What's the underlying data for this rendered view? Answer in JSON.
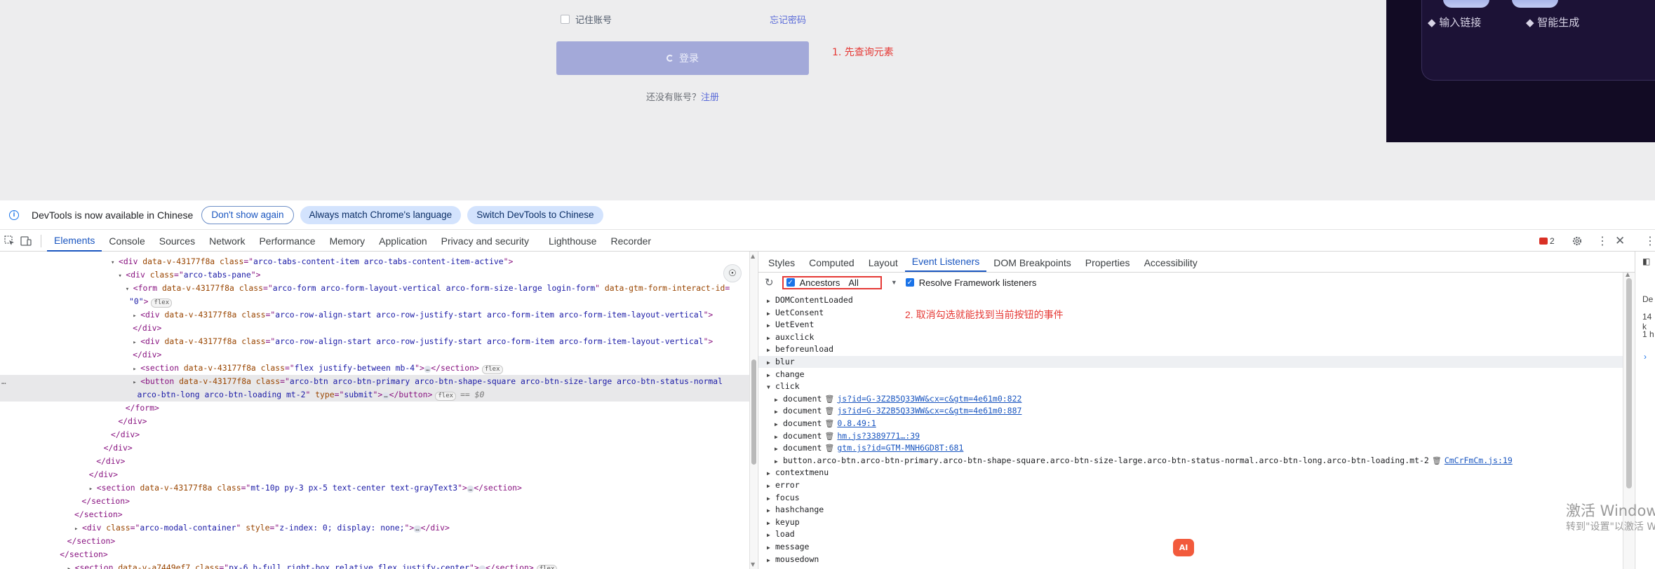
{
  "webpage": {
    "remember_label": "记住账号",
    "forgot_label": "忘记密码",
    "login_label": "登录",
    "annotation_1": "1. 先查询元素",
    "no_account_text": "还没有账号？",
    "signup_label": "注册",
    "promo_items": [
      "◆ 输入链接",
      "◆ 智能生成"
    ]
  },
  "banner": {
    "text": "DevTools is now available in Chinese",
    "btn_dont_show": "Don't show again",
    "btn_match": "Always match Chrome's language",
    "btn_switch": "Switch DevTools to Chinese"
  },
  "toolbar": {
    "tabs": [
      "Elements",
      "Console",
      "Sources",
      "Network",
      "Performance",
      "Memory",
      "Application",
      "Privacy and security",
      "Lighthouse",
      "Recorder"
    ],
    "error_count": "2"
  },
  "elements": {
    "lines": [
      {
        "indent": 8,
        "tri": "▾",
        "parts": [
          [
            "tag",
            "<div "
          ],
          [
            "attr",
            "data-v-43177f8a "
          ],
          [
            "attr",
            "class"
          ],
          [
            "tag",
            "=\""
          ],
          [
            "val",
            "arco-tabs-content-item arco-tabs-content-item-active"
          ],
          [
            "tag",
            "\">"
          ]
        ]
      },
      {
        "indent": 9,
        "tri": "▾",
        "parts": [
          [
            "tag",
            "<div "
          ],
          [
            "attr",
            "class"
          ],
          [
            "tag",
            "=\""
          ],
          [
            "val",
            "arco-tabs-pane"
          ],
          [
            "tag",
            "\">"
          ]
        ]
      },
      {
        "indent": 10,
        "tri": "▾",
        "parts": [
          [
            "tag",
            "<form "
          ],
          [
            "attr",
            "data-v-43177f8a "
          ],
          [
            "attr",
            "class"
          ],
          [
            "tag",
            "=\""
          ],
          [
            "val",
            "arco-form arco-form-layout-vertical arco-form-size-large login-form"
          ],
          [
            "tag",
            "\" "
          ],
          [
            "attr",
            "data-gtm-form-interact-id"
          ],
          [
            "tag",
            "="
          ]
        ]
      },
      {
        "indent": 10.5,
        "tri": "",
        "parts": [
          [
            "val",
            "\"0\""
          ],
          [
            "tag",
            ">"
          ]
        ],
        "pill": "flex"
      },
      {
        "indent": 11,
        "tri": "▸",
        "parts": [
          [
            "tag",
            "<div "
          ],
          [
            "attr",
            "data-v-43177f8a "
          ],
          [
            "attr",
            "class"
          ],
          [
            "tag",
            "=\""
          ],
          [
            "val",
            "arco-row-align-start arco-row-justify-start arco-form-item arco-form-item-layout-vertical"
          ],
          [
            "tag",
            "\">"
          ]
        ]
      },
      {
        "indent": 11,
        "tri": "",
        "parts": [
          [
            "tag",
            "</div>"
          ]
        ]
      },
      {
        "indent": 11,
        "tri": "▸",
        "parts": [
          [
            "tag",
            "<div "
          ],
          [
            "attr",
            "data-v-43177f8a "
          ],
          [
            "attr",
            "class"
          ],
          [
            "tag",
            "=\""
          ],
          [
            "val",
            "arco-row-align-start arco-row-justify-start arco-form-item arco-form-item-layout-vertical"
          ],
          [
            "tag",
            "\">"
          ]
        ]
      },
      {
        "indent": 11,
        "tri": "",
        "parts": [
          [
            "tag",
            "</div>"
          ]
        ]
      },
      {
        "indent": 11,
        "tri": "▸",
        "parts": [
          [
            "tag",
            "<section "
          ],
          [
            "attr",
            "data-v-43177f8a "
          ],
          [
            "attr",
            "class"
          ],
          [
            "tag",
            "=\""
          ],
          [
            "val",
            "flex justify-between mb-4"
          ],
          [
            "tag",
            "\">"
          ]
        ],
        "dots": true,
        "after": "</section>",
        "pill": "flex"
      },
      {
        "indent": 11,
        "tri": "▸",
        "parts": [
          [
            "tag",
            "<button "
          ],
          [
            "attr",
            "data-v-43177f8a "
          ],
          [
            "attr",
            "class"
          ],
          [
            "tag",
            "=\""
          ],
          [
            "val",
            "arco-btn arco-btn-primary arco-btn-shape-square arco-btn-size-large arco-btn-status-normal"
          ]
        ],
        "sel": true
      },
      {
        "indent": 11.6,
        "tri": "",
        "parts": [
          [
            "val",
            "arco-btn-long arco-btn-loading mt-2"
          ],
          [
            "tag",
            "\" "
          ],
          [
            "attr",
            "type"
          ],
          [
            "tag",
            "=\""
          ],
          [
            "val",
            "submit"
          ],
          [
            "tag",
            "\">"
          ]
        ],
        "dots": true,
        "after": "</button>",
        "pill": "flex",
        "eq": "== $0",
        "sel": true
      },
      {
        "indent": 10,
        "tri": "",
        "parts": [
          [
            "tag",
            "</form>"
          ]
        ]
      },
      {
        "indent": 9,
        "tri": "",
        "parts": [
          [
            "tag",
            "</div>"
          ]
        ]
      },
      {
        "indent": 8,
        "tri": "",
        "parts": [
          [
            "tag",
            "</div>"
          ]
        ]
      },
      {
        "indent": 7,
        "tri": "",
        "parts": [
          [
            "tag",
            "</div>"
          ]
        ]
      },
      {
        "indent": 6,
        "tri": "",
        "parts": [
          [
            "tag",
            "</div>"
          ]
        ]
      },
      {
        "indent": 5,
        "tri": "",
        "parts": [
          [
            "tag",
            "</div>"
          ]
        ]
      },
      {
        "indent": 5,
        "tri": "▸",
        "parts": [
          [
            "tag",
            "<section "
          ],
          [
            "attr",
            "data-v-43177f8a "
          ],
          [
            "attr",
            "class"
          ],
          [
            "tag",
            "=\""
          ],
          [
            "val",
            "mt-10p py-3 px-5 text-center text-grayText3"
          ],
          [
            "tag",
            "\">"
          ]
        ],
        "dots": true,
        "after": "</section>"
      },
      {
        "indent": 4,
        "tri": "",
        "parts": [
          [
            "tag",
            "</section>"
          ]
        ]
      },
      {
        "indent": 3,
        "tri": "",
        "parts": [
          [
            "tag",
            "</section>"
          ]
        ]
      },
      {
        "indent": 3,
        "tri": "▸",
        "parts": [
          [
            "tag",
            "<div "
          ],
          [
            "attr",
            "class"
          ],
          [
            "tag",
            "=\""
          ],
          [
            "val",
            "arco-modal-container"
          ],
          [
            "tag",
            "\" "
          ],
          [
            "attr",
            "style"
          ],
          [
            "tag",
            "=\""
          ],
          [
            "val",
            "z-index: 0; display: none;"
          ],
          [
            "tag",
            "\">"
          ]
        ],
        "dots": true,
        "after": "</div>"
      },
      {
        "indent": 2,
        "tri": "",
        "parts": [
          [
            "tag",
            "</section>"
          ]
        ]
      },
      {
        "indent": 1,
        "tri": "",
        "parts": [
          [
            "tag",
            "</section>"
          ]
        ]
      },
      {
        "indent": 2,
        "tri": "▸",
        "parts": [
          [
            "tag",
            "<section "
          ],
          [
            "attr",
            "data-v-a7449ef7 "
          ],
          [
            "attr",
            "class"
          ],
          [
            "tag",
            "=\""
          ],
          [
            "val",
            "px-6 h-full right-box relative flex justify-center"
          ],
          [
            "tag",
            "\">"
          ]
        ],
        "dots": true,
        "after": "</section>",
        "pill": "flex"
      }
    ]
  },
  "sidebar": {
    "tabs": [
      "Styles",
      "Computed",
      "Layout",
      "Event Listeners",
      "DOM Breakpoints",
      "Properties",
      "Accessibility"
    ],
    "ancestors_label": "Ancestors",
    "filter_value": "All",
    "resolve_label": "Resolve Framework listeners",
    "annotation_2": "2. 取消勾选就能找到当前按钮的事件",
    "events": [
      {
        "name": "DOMContentLoaded",
        "open": false
      },
      {
        "name": "UetConsent",
        "open": false
      },
      {
        "name": "UetEvent",
        "open": false
      },
      {
        "name": "auxclick",
        "open": false
      },
      {
        "name": "beforeunload",
        "open": false
      },
      {
        "name": "blur",
        "open": false,
        "hl": true
      },
      {
        "name": "change",
        "open": false
      },
      {
        "name": "click",
        "open": true
      }
    ],
    "click_listeners": [
      {
        "target": "document",
        "source": "js?id=G-3Z2B5Q33WW&cx=c&gtm=4e61m0:822"
      },
      {
        "target": "document",
        "source": "js?id=G-3Z2B5Q33WW&cx=c&gtm=4e61m0:887"
      },
      {
        "target": "document",
        "source": "0.8.49:1"
      },
      {
        "target": "document",
        "source": "hm.js?3389771…:39"
      },
      {
        "target": "document",
        "source": "gtm.js?id=GTM-MNH6GD8T:681"
      },
      {
        "target": "button.arco-btn.arco-btn-primary.arco-btn-shape-square.arco-btn-size-large.arco-btn-status-normal.arco-btn-long.arco-btn-loading.mt-2",
        "source": "CmCrFmCm.js:19"
      }
    ],
    "events_after": [
      "contextmenu",
      "error",
      "focus",
      "hashchange",
      "keyup",
      "load",
      "message",
      "mousedown"
    ],
    "watermark_line1": "激活 Windows",
    "watermark_line2": "转到\"设置\"以激活 Windows。",
    "ai_badge": "AI"
  },
  "right_strip": {
    "labels": [
      "De",
      "14 k",
      "1 h"
    ]
  }
}
